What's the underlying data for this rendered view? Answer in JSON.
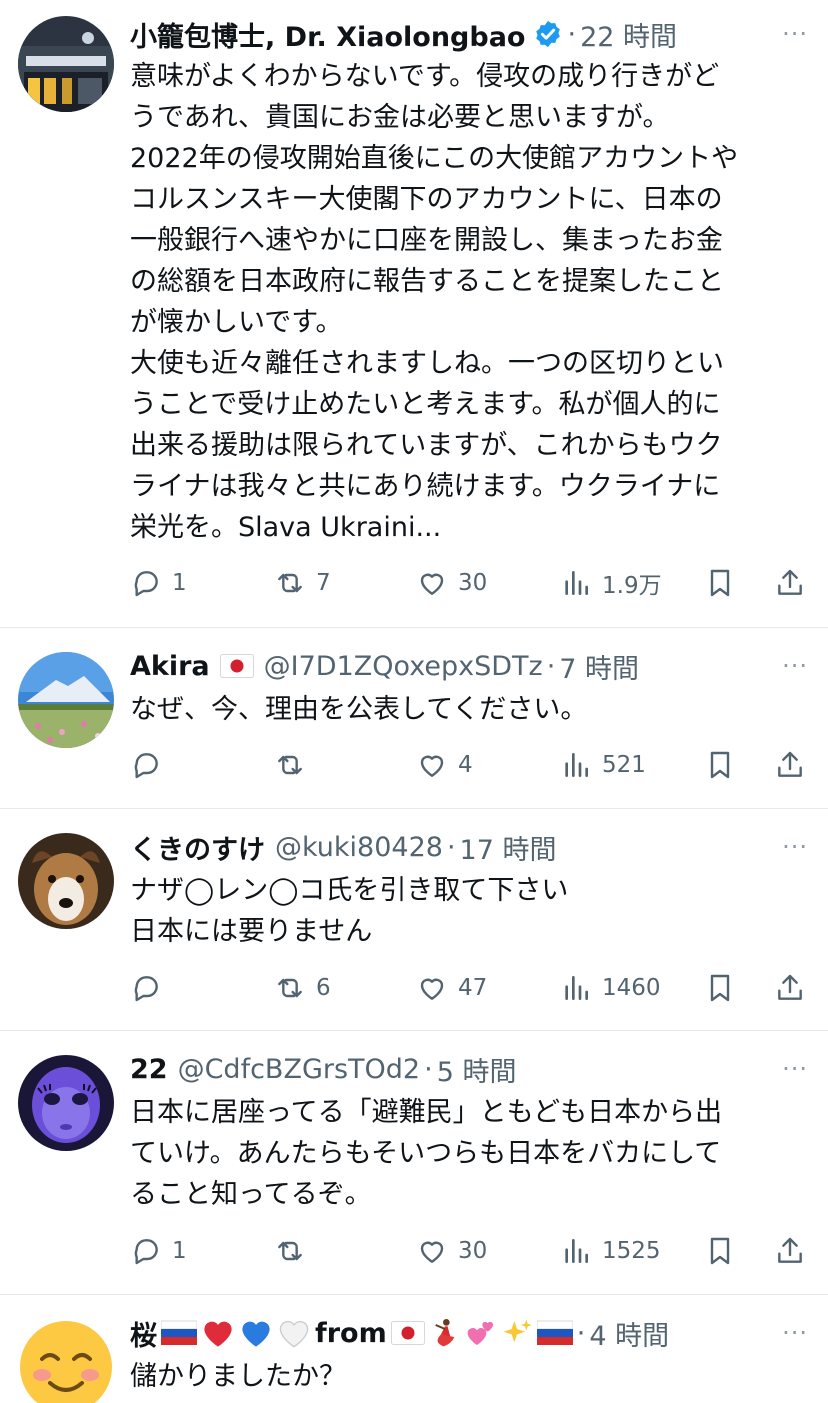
{
  "tweets": [
    {
      "name": "小籠包博士, Dr. Xiaolongbao",
      "handle": "",
      "time": "22 時間",
      "verified": true,
      "avatar": "building-photo",
      "lines": [
        "意味がよくわからないです。侵攻の成り行きがど",
        "うであれ、貴国にお金は必要と思いますが。",
        "2022年の侵攻開始直後にこの大使館アカウントや",
        "コルスンスキー大使閣下のアカウントに、日本の",
        "一般銀行へ速やかに口座を開設し、集まったお金",
        "の総額を日本政府に報告することを提案したこと",
        "が懐かしいです。",
        "大使も近々離任されますしね。一つの区切りとい",
        "うことで受け止めたいと考えます。私が個人的に",
        "出来る援助は限られていますが、これからもウク",
        "ライナは我々と共にあり続けます。ウクライナに",
        "栄光を。Slava Ukraini..."
      ],
      "replies": "1",
      "retweets": "7",
      "likes": "30",
      "views": "1.9万"
    },
    {
      "name": "Akira",
      "flag": "🇯🇵",
      "handle": "@I7D1ZQoxepxSDTz",
      "time": "7 時間",
      "avatar": "mountain-field-photo",
      "lines": [
        "なぜ、今、理由を公表してください。"
      ],
      "replies": "",
      "retweets": "",
      "likes": "4",
      "views": "521"
    },
    {
      "name": "くきのすけ",
      "handle": "@kuki80428",
      "time": "17 時間",
      "avatar": "dog-photo",
      "lines": [
        "ナザ◯レン◯コ氏を引き取て下さい",
        "日本には要りません"
      ],
      "replies": "",
      "retweets": "6",
      "likes": "47",
      "views": "1460"
    },
    {
      "name": "22",
      "handle": "@CdfcBZGrsTOd2",
      "time": "5 時間",
      "avatar": "doll-face-photo",
      "lines": [
        "日本に居座ってる「避難民」ともども日本から出",
        "ていけ。あんたらもそいつらも日本をバカにして",
        "ること知ってるぞ。"
      ],
      "replies": "1",
      "retweets": "",
      "likes": "30",
      "views": "1525"
    },
    {
      "name": "桜",
      "name_suffix": "from",
      "time": "4 時間",
      "avatar": "smiling-face-emoji",
      "lines": [
        "儲かりましたか？"
      ]
    }
  ],
  "more_label": "···",
  "colors": {
    "text": "#0f1419",
    "secondary": "#536471",
    "verified": "#1d9bf0",
    "divider": "#e6e9ec"
  }
}
